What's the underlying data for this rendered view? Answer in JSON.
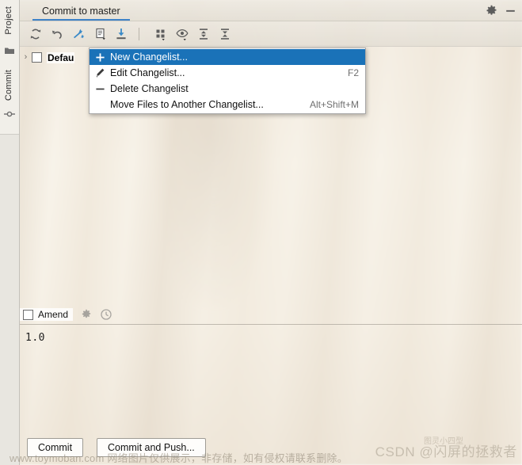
{
  "window": {
    "tab_title": "Commit to master",
    "settings_icon": "gear-icon",
    "minimize_icon": "minimize-icon"
  },
  "left_stripe": {
    "tabs": [
      {
        "label": "Project",
        "icon": "folder-icon"
      },
      {
        "label": "Commit",
        "icon": "commit-node-icon"
      }
    ]
  },
  "toolbar": {
    "buttons": [
      {
        "name": "refresh-changes-button",
        "icon": "refresh-icon"
      },
      {
        "name": "rollback-button",
        "icon": "rollback-icon"
      },
      {
        "name": "shelve-changes-button",
        "icon": "shelve-icon"
      },
      {
        "name": "show-diff-button",
        "icon": "diff-document-icon"
      },
      {
        "name": "update-project-button",
        "icon": "download-icon"
      },
      {
        "name": "group-by-button",
        "icon": "group-by-icon"
      },
      {
        "name": "show-ignored-button",
        "icon": "eye-icon"
      },
      {
        "name": "expand-all-button",
        "icon": "expand-all-icon"
      },
      {
        "name": "collapse-all-button",
        "icon": "collapse-all-icon"
      }
    ]
  },
  "changes": {
    "changelist_label": "Defau",
    "chevron": "›",
    "checked": false
  },
  "context_menu": {
    "items": [
      {
        "label": "New Changelist...",
        "shortcut": "",
        "icon": "plus-icon",
        "selected": true
      },
      {
        "label": "Edit Changelist...",
        "shortcut": "F2",
        "icon": "pencil-icon",
        "selected": false
      },
      {
        "label": "Delete Changelist",
        "shortcut": "",
        "icon": "minus-icon",
        "selected": false
      },
      {
        "label": "Move Files to Another Changelist...",
        "shortcut": "Alt+Shift+M",
        "icon": "",
        "selected": false
      }
    ]
  },
  "amend": {
    "label": "Amend",
    "checked": false,
    "icons": [
      {
        "name": "commit-options-gear-icon",
        "icon": "gear-icon"
      },
      {
        "name": "commit-history-icon",
        "icon": "clock-icon"
      }
    ]
  },
  "commit_message": {
    "value": "1.0"
  },
  "actions": {
    "commit_label": "Commit",
    "commit_and_push_label": "Commit and Push..."
  },
  "watermarks": {
    "bottom": "www.toymoban.com 网络图片仅供展示，非存储，如有侵权请联系删除。",
    "csdn": "CSDN @闪屏的拯救者",
    "logo": "图灵小四型"
  },
  "colors": {
    "accent": "#3d82c8",
    "menu_selection": "#1a72b8",
    "icon_blue": "#3a8ac8",
    "panel_bg": "#f1efe9",
    "stripe_bg": "#e8e6e0"
  }
}
